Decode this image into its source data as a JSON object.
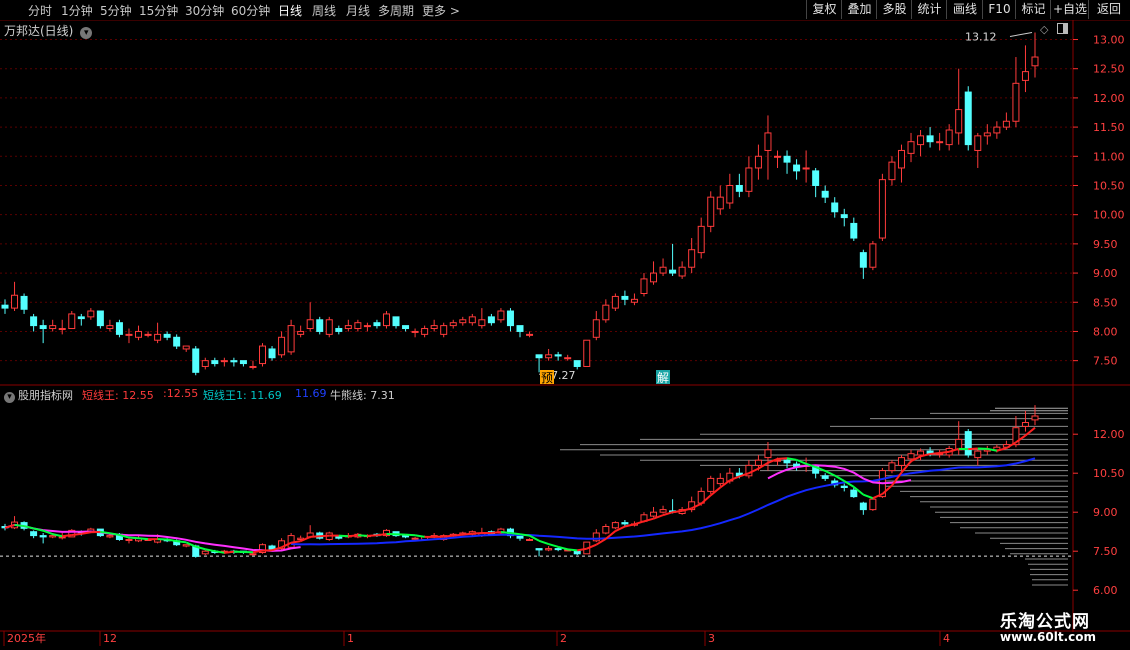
{
  "toolbar": {
    "periods": [
      "分时",
      "1分钟",
      "5分钟",
      "15分钟",
      "30分钟",
      "60分钟",
      "日线",
      "周线",
      "月线",
      "多周期",
      "更多"
    ],
    "active_period": "日线",
    "buttons": [
      "复权",
      "叠加",
      "多股",
      "统计",
      "画线",
      "F10",
      "标记",
      "+自选",
      "返回"
    ]
  },
  "main_panel": {
    "title": "万邦达(日线)",
    "high_label": "13.12",
    "low_label": "7.27",
    "marker_left": "预",
    "marker_right": "解",
    "y_ticks": [
      "13.00",
      "12.50",
      "12.00",
      "11.50",
      "11.00",
      "10.50",
      "10.00",
      "9.50",
      "9.00",
      "8.50",
      "8.00",
      "7.50"
    ]
  },
  "indicator_panel": {
    "name": "股朋指标网",
    "items": [
      {
        "label": "短线王:",
        "value": "12.55",
        "color": "#ff3b3b"
      },
      {
        "label": ":12.55",
        "value": "",
        "color": "#ff3b3b"
      },
      {
        "label": "短线王1:",
        "value": "11.69",
        "color": "#00c8c8"
      },
      {
        "label": "11.69",
        "value": "",
        "color": "#2040ff"
      },
      {
        "label": "牛熊线:",
        "value": "7.31",
        "color": "#d0d0d0"
      }
    ],
    "y_ticks": [
      "12.00",
      "10.50",
      "9.00",
      "7.50",
      "6.00"
    ]
  },
  "date_axis": {
    "labels": [
      "2025年",
      "12",
      "1",
      "2",
      "3",
      "4"
    ]
  },
  "watermark": {
    "line1": "乐淘公式网",
    "line2": "www.60lt.com"
  },
  "colors": {
    "up": "#ff3b3b",
    "down": "#54ffff",
    "ma_fast_up": "#ff2020",
    "ma_fast_down": "#00ff40",
    "ma_mid": "#ff30ff",
    "ma_slow": "#1428ff",
    "grid": "#5a0000"
  },
  "chart_data": {
    "type": "candlestick",
    "title": "万邦达(日线)",
    "ylim": [
      7.1,
      13.3
    ],
    "candles": [
      [
        8.45,
        8.4,
        8.55,
        8.3
      ],
      [
        8.4,
        8.62,
        8.85,
        8.35
      ],
      [
        8.6,
        8.38,
        8.65,
        8.3
      ],
      [
        8.25,
        8.1,
        8.3,
        8.0
      ],
      [
        8.1,
        8.05,
        8.2,
        7.8
      ],
      [
        8.05,
        8.1,
        8.2,
        8.0
      ],
      [
        8.05,
        8.05,
        8.2,
        7.95
      ],
      [
        8.05,
        8.3,
        8.35,
        8.05
      ],
      [
        8.25,
        8.22,
        8.3,
        8.1
      ],
      [
        8.25,
        8.35,
        8.4,
        8.2
      ],
      [
        8.35,
        8.1,
        8.35,
        8.05
      ],
      [
        8.05,
        8.1,
        8.2,
        8.0
      ],
      [
        8.15,
        7.95,
        8.2,
        7.9
      ],
      [
        7.95,
        7.95,
        8.05,
        7.8
      ],
      [
        7.9,
        8.0,
        8.1,
        7.85
      ],
      [
        7.95,
        7.95,
        8.0,
        7.9
      ],
      [
        7.85,
        7.95,
        8.15,
        7.8
      ],
      [
        7.95,
        7.9,
        8.0,
        7.85
      ],
      [
        7.9,
        7.75,
        7.95,
        7.7
      ],
      [
        7.7,
        7.75,
        7.75,
        7.65
      ],
      [
        7.7,
        7.3,
        7.75,
        7.25
      ],
      [
        7.4,
        7.5,
        7.55,
        7.35
      ],
      [
        7.5,
        7.45,
        7.55,
        7.4
      ],
      [
        7.5,
        7.5,
        7.55,
        7.4
      ],
      [
        7.5,
        7.48,
        7.55,
        7.4
      ],
      [
        7.5,
        7.45,
        7.5,
        7.4
      ],
      [
        7.4,
        7.4,
        7.5,
        7.35
      ],
      [
        7.45,
        7.75,
        7.8,
        7.4
      ],
      [
        7.7,
        7.55,
        7.75,
        7.5
      ],
      [
        7.6,
        7.9,
        8.0,
        7.55
      ],
      [
        7.65,
        8.1,
        8.2,
        7.6
      ],
      [
        7.95,
        8.0,
        8.1,
        7.9
      ],
      [
        8.05,
        8.2,
        8.5,
        8.0
      ],
      [
        8.2,
        8.0,
        8.25,
        7.95
      ],
      [
        7.95,
        8.2,
        8.25,
        7.9
      ],
      [
        8.05,
        8.0,
        8.1,
        7.95
      ],
      [
        8.05,
        8.1,
        8.2,
        8.0
      ],
      [
        8.05,
        8.15,
        8.2,
        8.0
      ],
      [
        8.1,
        8.1,
        8.15,
        8.0
      ],
      [
        8.15,
        8.1,
        8.2,
        8.05
      ],
      [
        8.1,
        8.3,
        8.35,
        8.05
      ],
      [
        8.25,
        8.1,
        8.25,
        8.05
      ],
      [
        8.1,
        8.05,
        8.1,
        8.0
      ],
      [
        8.0,
        8.0,
        8.05,
        7.9
      ],
      [
        7.95,
        8.05,
        8.1,
        7.9
      ],
      [
        8.05,
        8.1,
        8.2,
        8.0
      ],
      [
        7.95,
        8.1,
        8.15,
        7.9
      ],
      [
        8.1,
        8.15,
        8.2,
        8.05
      ],
      [
        8.15,
        8.2,
        8.25,
        8.1
      ],
      [
        8.15,
        8.25,
        8.3,
        8.1
      ],
      [
        8.1,
        8.2,
        8.4,
        8.05
      ],
      [
        8.25,
        8.15,
        8.3,
        8.1
      ],
      [
        8.2,
        8.35,
        8.4,
        8.15
      ],
      [
        8.35,
        8.1,
        8.4,
        8.0
      ],
      [
        8.1,
        8.0,
        8.1,
        7.9
      ],
      [
        7.95,
        7.95,
        8.0,
        7.9
      ],
      [
        7.6,
        7.55,
        7.6,
        7.3
      ],
      [
        7.55,
        7.6,
        7.7,
        7.5
      ],
      [
        7.6,
        7.58,
        7.65,
        7.5
      ],
      [
        7.55,
        7.55,
        7.6,
        7.5
      ],
      [
        7.5,
        7.4,
        7.5,
        7.35
      ],
      [
        7.4,
        7.85,
        7.85,
        7.4
      ],
      [
        7.9,
        8.2,
        8.35,
        7.85
      ],
      [
        8.2,
        8.45,
        8.55,
        8.15
      ],
      [
        8.4,
        8.6,
        8.65,
        8.35
      ],
      [
        8.6,
        8.55,
        8.7,
        8.45
      ],
      [
        8.5,
        8.55,
        8.65,
        8.45
      ],
      [
        8.65,
        8.9,
        9.0,
        8.6
      ],
      [
        8.85,
        9.0,
        9.2,
        8.8
      ],
      [
        9.0,
        9.1,
        9.25,
        8.95
      ],
      [
        9.05,
        9.0,
        9.5,
        8.95
      ],
      [
        8.95,
        9.1,
        9.2,
        8.9
      ],
      [
        9.1,
        9.4,
        9.6,
        9.0
      ],
      [
        9.35,
        9.8,
        9.95,
        9.25
      ],
      [
        9.8,
        10.3,
        10.4,
        9.7
      ],
      [
        10.1,
        10.3,
        10.5,
        10.0
      ],
      [
        10.2,
        10.5,
        10.7,
        10.1
      ],
      [
        10.5,
        10.4,
        10.7,
        10.3
      ],
      [
        10.4,
        10.8,
        11.0,
        10.3
      ],
      [
        10.8,
        11.0,
        11.2,
        10.6
      ],
      [
        11.1,
        11.4,
        11.7,
        10.6
      ],
      [
        11.0,
        11.0,
        11.1,
        10.8
      ],
      [
        11.0,
        10.9,
        11.1,
        10.7
      ],
      [
        10.85,
        10.75,
        10.95,
        10.6
      ],
      [
        10.8,
        10.8,
        11.1,
        10.55
      ],
      [
        10.75,
        10.5,
        10.8,
        10.3
      ],
      [
        10.4,
        10.3,
        10.5,
        10.2
      ],
      [
        10.2,
        10.05,
        10.3,
        9.95
      ],
      [
        10.0,
        9.95,
        10.1,
        9.8
      ],
      [
        9.85,
        9.6,
        9.95,
        9.55
      ],
      [
        9.35,
        9.1,
        9.4,
        8.9
      ],
      [
        9.1,
        9.5,
        9.55,
        9.05
      ],
      [
        9.6,
        10.6,
        10.7,
        9.55
      ],
      [
        10.6,
        10.9,
        11.0,
        10.5
      ],
      [
        10.8,
        11.1,
        11.2,
        10.55
      ],
      [
        11.05,
        11.25,
        11.4,
        10.9
      ],
      [
        11.2,
        11.35,
        11.45,
        11.0
      ],
      [
        11.35,
        11.25,
        11.5,
        11.15
      ],
      [
        11.25,
        11.25,
        11.4,
        11.1
      ],
      [
        11.2,
        11.45,
        11.55,
        11.1
      ],
      [
        11.4,
        11.8,
        12.5,
        11.2
      ],
      [
        12.1,
        11.2,
        12.2,
        11.1
      ],
      [
        11.1,
        11.35,
        11.4,
        10.8
      ],
      [
        11.35,
        11.4,
        11.55,
        11.2
      ],
      [
        11.4,
        11.5,
        11.6,
        11.3
      ],
      [
        11.5,
        11.6,
        11.75,
        11.45
      ],
      [
        11.6,
        12.25,
        12.7,
        11.5
      ],
      [
        12.3,
        12.45,
        12.9,
        12.1
      ],
      [
        12.55,
        12.7,
        13.12,
        12.35
      ]
    ],
    "high": 13.12,
    "low": 7.27,
    "indicator": {
      "ylim": [
        5.7,
        13.2
      ],
      "short_king": 12.55,
      "short_king1": 11.69,
      "bull_bear_line": 7.31
    }
  }
}
